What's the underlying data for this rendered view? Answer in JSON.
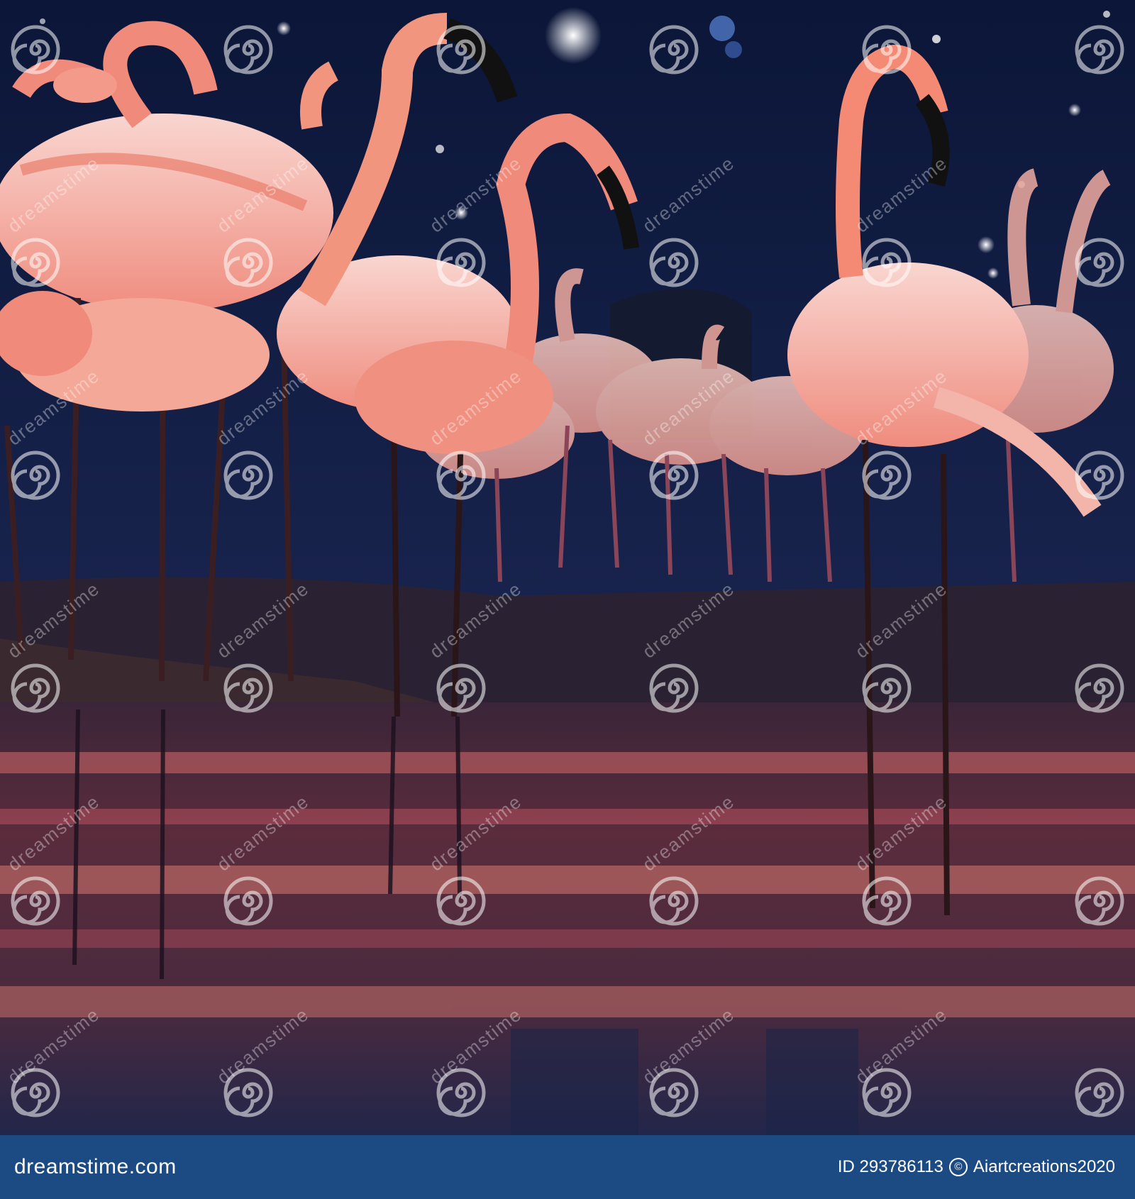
{
  "scene": {
    "description_colors": {
      "sky": "#0e1b3d",
      "water": "#1b2344",
      "flamingo_pink": "#f28c82",
      "flamingo_light": "#f7d2cc",
      "beak_black": "#111111",
      "reflection": "#c45a5a"
    }
  },
  "watermark": {
    "text": "dreamstime",
    "icon": "dreamstime-spiral-icon"
  },
  "footer": {
    "brand_text": "dreamstime.com",
    "image_id": "ID 293786113",
    "author": "Aiartcreations2020",
    "background_color": "#1c4a82"
  }
}
